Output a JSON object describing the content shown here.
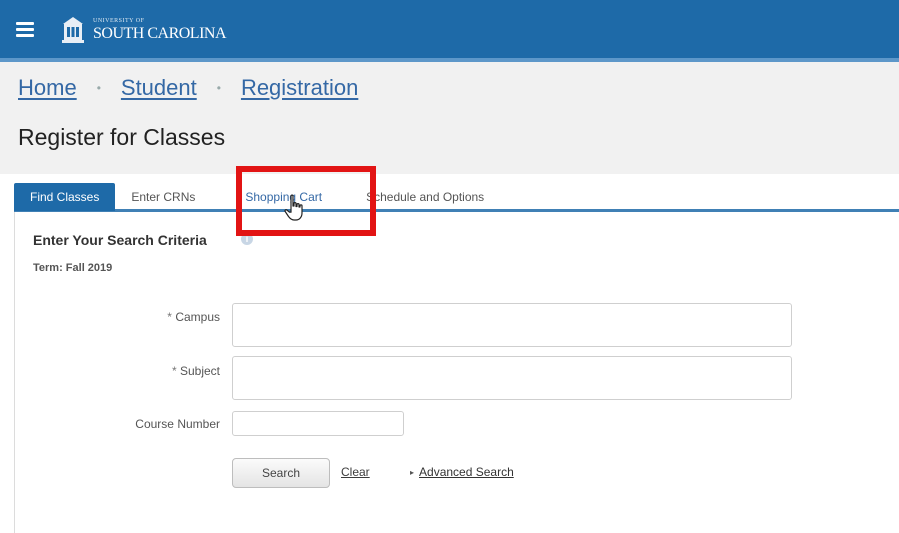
{
  "header": {
    "logo_line1": "UNIVERSITY OF",
    "logo_line2": "SOUTH CAROLINA"
  },
  "breadcrumb": {
    "items": [
      "Home",
      "Student",
      "Registration"
    ],
    "separator": "•"
  },
  "page": {
    "title": "Register for Classes"
  },
  "tabs": [
    {
      "label": "Find Classes",
      "active": true
    },
    {
      "label": "Enter CRNs",
      "active": false
    },
    {
      "label": "Shopping Cart",
      "active": false
    },
    {
      "label": "Schedule and Options",
      "active": false
    }
  ],
  "search": {
    "heading": "Enter Your Search Criteria",
    "info_icon": "i",
    "term": "Term: Fall 2019",
    "required_mark": "*",
    "campus_label": "Campus",
    "campus_value": "",
    "subject_label": "Subject",
    "subject_value": "",
    "course_number_label": "Course Number",
    "course_number_value": "",
    "search_button": "Search",
    "clear_link": "Clear",
    "advanced_caret": "▸",
    "advanced_search": "Advanced Search"
  },
  "colors": {
    "brand_blue": "#1e6aa8",
    "highlight_red": "#e21414",
    "link_blue": "#3468a5"
  },
  "icons": [
    "hamburger-menu-icon",
    "university-crest-icon",
    "info-icon",
    "hand-pointer-cursor-icon"
  ]
}
